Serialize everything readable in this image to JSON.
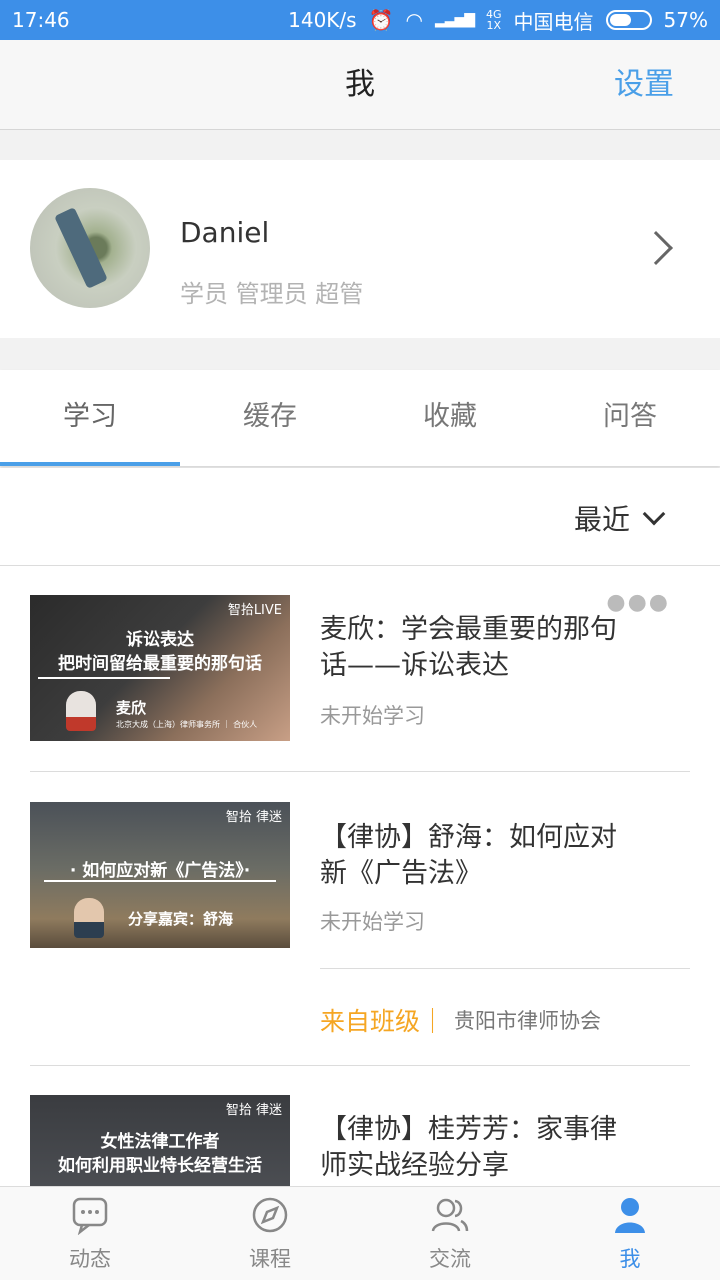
{
  "status_bar": {
    "time": "17:46",
    "speed": "140K/s",
    "network_type": "4G",
    "network_sub": "1X",
    "carrier": "中国电信",
    "battery": "57%",
    "battery_level": 0.57
  },
  "nav": {
    "title": "我",
    "settings": "设置"
  },
  "profile": {
    "name": "Daniel",
    "roles": "学员 管理员 超管"
  },
  "tabs": [
    {
      "label": "学习",
      "active": true
    },
    {
      "label": "缓存",
      "active": false
    },
    {
      "label": "收藏",
      "active": false
    },
    {
      "label": "问答",
      "active": false
    }
  ],
  "sort": {
    "label": "最近"
  },
  "courses": [
    {
      "title": "麦欣：学会最重要的那句话——诉讼表达",
      "status": "未开始学习",
      "thumb": {
        "brand": "智拾LIVE",
        "line1": "诉讼表达",
        "line2": "把时间留给最重要的那句话",
        "speaker": "麦欣",
        "caption": "北京大成（上海）律师事务所 ｜ 合伙人"
      }
    },
    {
      "title": "【律协】舒海：如何应对新《广告法》",
      "status": "未开始学习",
      "from_class_label": "来自班级｜",
      "from_class_org": "贵阳市律师协会",
      "thumb": {
        "brand": "智拾 律迷",
        "line1": "· 如何应对新《广告法》·",
        "speaker": "分享嘉宾：舒海"
      }
    },
    {
      "title": "【律协】桂芳芳：家事律师实战经验分享",
      "thumb": {
        "brand": "智拾 律迷",
        "line1": "女性法律工作者",
        "line2": "如何利用职业特长经营生活"
      }
    }
  ],
  "bottom_nav": [
    {
      "label": "动态",
      "icon": "chat-bubble-icon",
      "active": false
    },
    {
      "label": "课程",
      "icon": "compass-icon",
      "active": false
    },
    {
      "label": "交流",
      "icon": "people-icon",
      "active": false
    },
    {
      "label": "我",
      "icon": "person-icon",
      "active": true
    }
  ],
  "colors": {
    "accent": "#3d8fe8",
    "highlight": "#f5a623"
  }
}
